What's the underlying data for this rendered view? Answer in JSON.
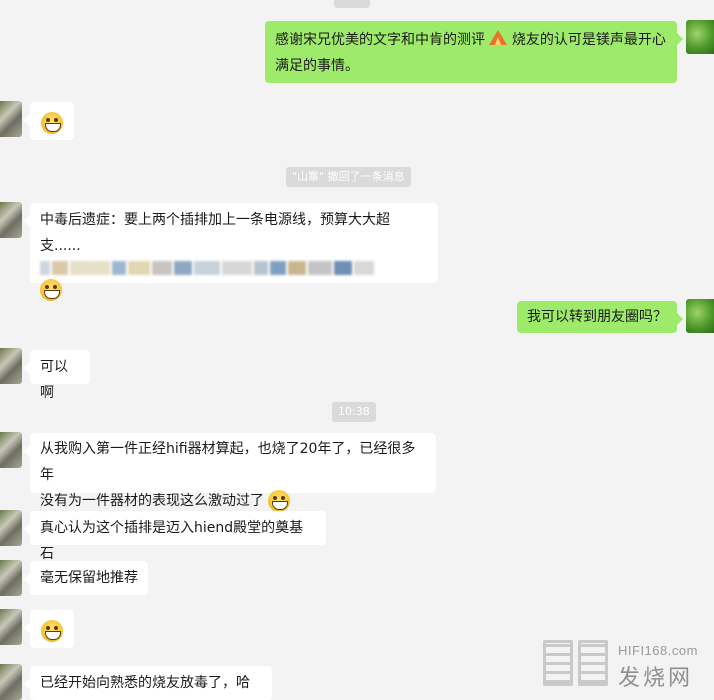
{
  "chat": {
    "msg1_text": "感谢宋兄优美的文字和中肯的测评",
    "msg1_text_cont": "烧友的认可是镁声最开心满足的事情。",
    "recall_notice": "\"山寨\" 撤回了一条消息",
    "msg3_line1": "中毒后遗症：要上两个插排加上一条电源线，预算大大超支......",
    "msg4_text": "我可以转到朋友圈吗？",
    "msg5_text": "可以啊",
    "time_label": "10:38",
    "msg6_line1": "从我购入第一件正经hifi器材算起，也烧了20年了，已经很多年",
    "msg6_line2": "没有为一件器材的表现这么激动过了",
    "msg7_text": "真心认为这个插排是迈入hiend殿堂的奠基石",
    "msg8_text": "毫无保留地推荐",
    "msg10_text": "已经开始向熟悉的烧友放毒了，哈哈"
  },
  "icons": {
    "emoji": "grinning-face-icon",
    "tent": "tent-icon"
  },
  "watermark": {
    "domain": "HIFI168.com",
    "name": "发烧网"
  },
  "colors": {
    "background": "#f3f3f3",
    "bubble_left": "#ffffff",
    "bubble_right": "#9eea6a"
  }
}
